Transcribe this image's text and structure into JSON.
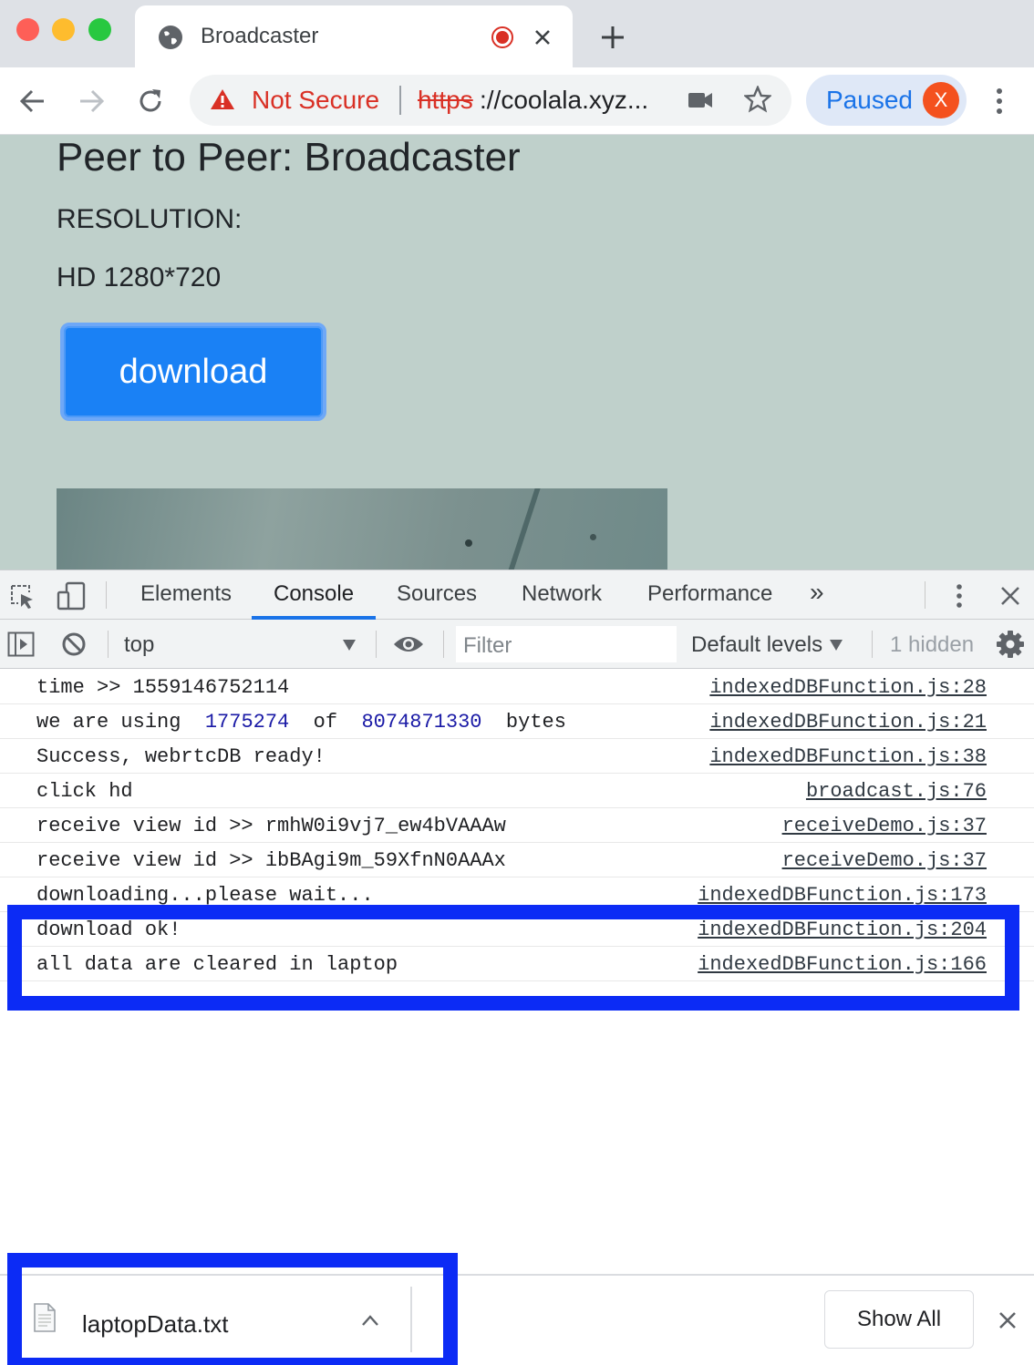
{
  "browser": {
    "tab_title": "Broadcaster",
    "new_tab_symbol": "+",
    "not_secure_label": "Not Secure",
    "url_scheme": "https",
    "url_rest": "://coolala.xyz...",
    "paused_label": "Paused",
    "profile_initial": "X",
    "profile_color": "#f4511e"
  },
  "page": {
    "title": "Peer to Peer: Broadcaster",
    "resolution_label": "RESOLUTION:",
    "resolution_value": "HD 1280*720",
    "download_button": "download"
  },
  "devtools": {
    "tabs": [
      "Elements",
      "Console",
      "Sources",
      "Network",
      "Performance"
    ],
    "active_tab": "Console",
    "more_tabs_symbol": "»",
    "context": "top",
    "filter_placeholder": "Filter",
    "levels": "Default levels",
    "hidden_count": "1 hidden",
    "console": [
      {
        "message": "time >> 1559146752114",
        "source": "indexedDBFunction.js:28"
      },
      {
        "message_parts": [
          "we are using  ",
          "1775274",
          "  of  ",
          "8074871330",
          "  bytes"
        ],
        "source": "indexedDBFunction.js:21"
      },
      {
        "message": "Success, webrtcDB ready!",
        "source": "indexedDBFunction.js:38"
      },
      {
        "message": "click hd",
        "source": "broadcast.js:76"
      },
      {
        "message": "receive view id >> rmhW0i9vj7_ew4bVAAAw",
        "source": "receiveDemo.js:37"
      },
      {
        "message": "receive view id >> ibBAgi9m_59XfnN0AAAx",
        "source": "receiveDemo.js:37"
      },
      {
        "message": "downloading...please wait...",
        "source": "indexedDBFunction.js:173"
      },
      {
        "message": "download ok!",
        "source": "indexedDBFunction.js:204"
      },
      {
        "message": "all data are cleared in laptop",
        "source": "indexedDBFunction.js:166"
      }
    ]
  },
  "downloads": {
    "file_name": "laptopData.txt",
    "show_all": "Show All"
  },
  "colors": {
    "highlight": "#0c2bf5",
    "page_bg": "#bfd0cb",
    "button_blue": "#1a81f5",
    "not_secure_red": "#d93025",
    "link_number_blue": "#1a1aa6"
  }
}
